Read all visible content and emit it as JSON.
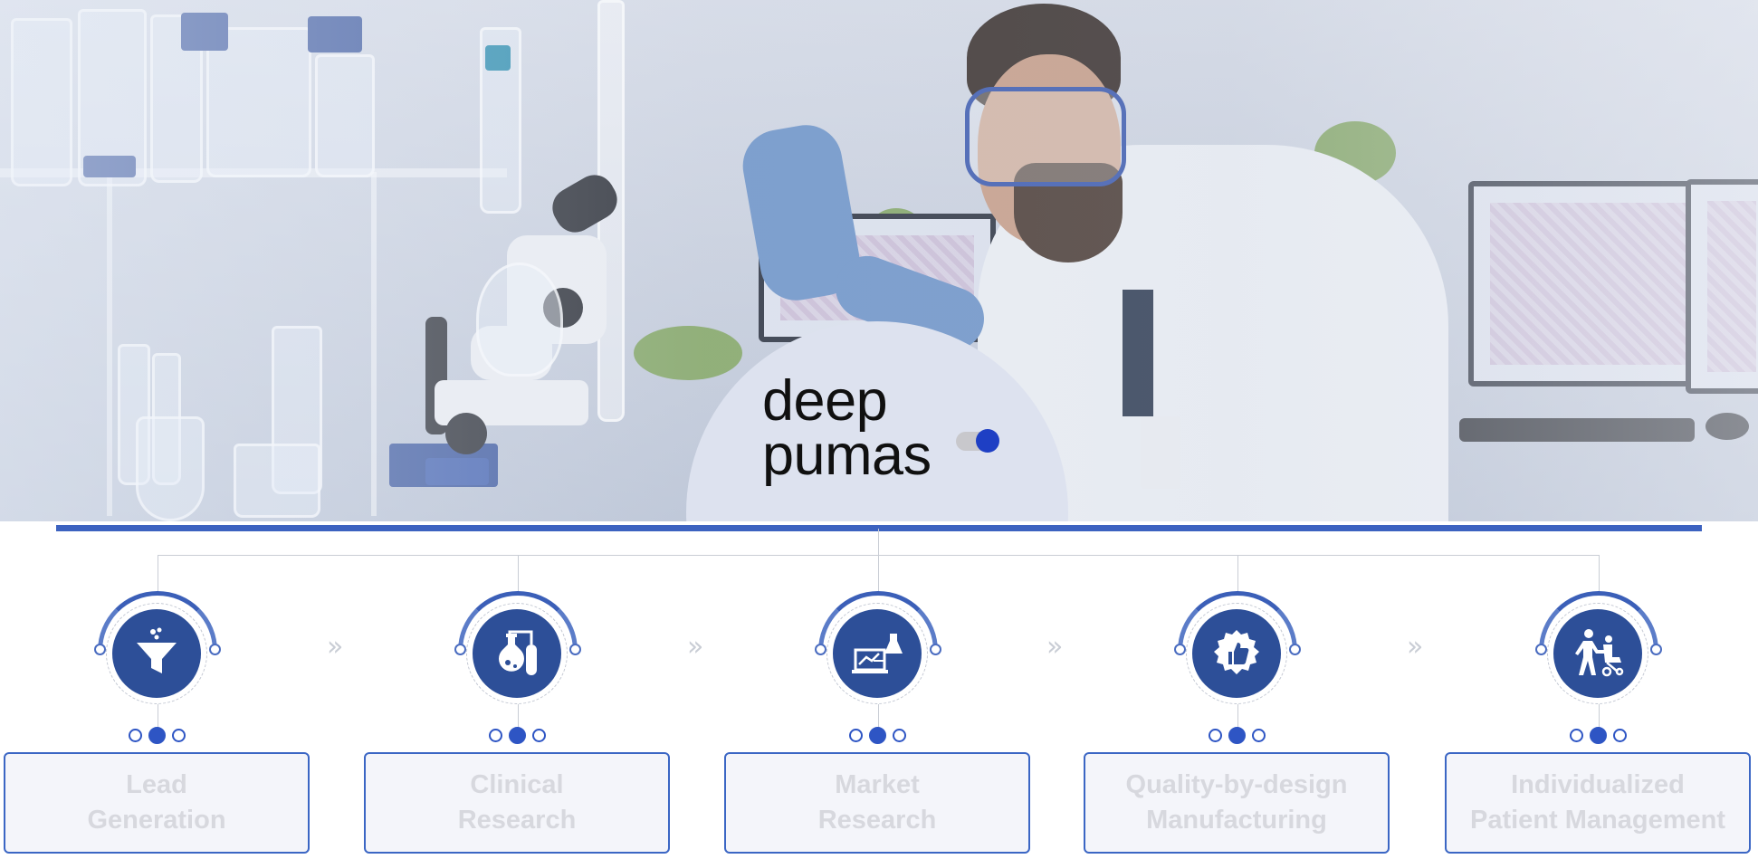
{
  "brand": {
    "line1": "deep",
    "line2": "pumas",
    "accent_color": "#1e3fc4",
    "bar_color": "#3c62c0"
  },
  "hero": {
    "image": "photo of a scientist in a lab holding a pipette over a plant sample, microscope and glassware in foreground, monitors in background"
  },
  "steps": [
    {
      "label": "Lead\nGeneration",
      "icon": "funnel-icon",
      "active_dot": 2
    },
    {
      "label": "Clinical\nResearch",
      "icon": "lab-flasks-icon",
      "active_dot": 2
    },
    {
      "label": "Market\nResearch",
      "icon": "laptop-analytics-flask-icon",
      "active_dot": 2
    },
    {
      "label": "Quality-by-design\nManufacturing",
      "icon": "thumbs-up-badge-icon",
      "active_dot": 2
    },
    {
      "label": "Individualized\nPatient Management",
      "icon": "patient-wheelchair-icon",
      "active_dot": 2
    }
  ],
  "separator_glyph": "»",
  "colors": {
    "icon_fill": "#2d4f98",
    "box_border": "#3b66c4",
    "label_text": "#d7d8de"
  }
}
